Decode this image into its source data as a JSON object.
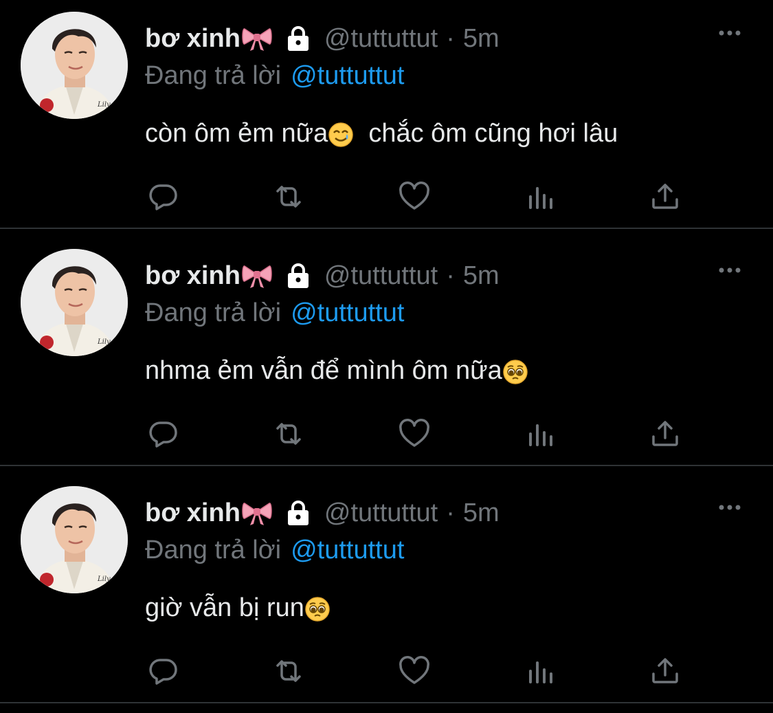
{
  "colors": {
    "background": "#000000",
    "text": "#e7e9ea",
    "muted": "#71767b",
    "link": "#1d9bf0",
    "divider": "#2f3336"
  },
  "tweets": [
    {
      "display_name": "bơ xinh",
      "name_emoji": "ribbon-bow-icon",
      "protected_icon": "lock-icon",
      "handle": "@tuttuttut",
      "separator": "·",
      "time": "5m",
      "reply_prefix": "Đang trả lời",
      "reply_target": "@tuttuttut",
      "text_before_emoji": "còn ôm ẻm nữa",
      "text_emoji": "smiling-face-with-tear-icon",
      "text_after_emoji": "  chắc ôm cũng hơi lâu"
    },
    {
      "display_name": "bơ xinh",
      "name_emoji": "ribbon-bow-icon",
      "protected_icon": "lock-icon",
      "handle": "@tuttuttut",
      "separator": "·",
      "time": "5m",
      "reply_prefix": "Đang trả lời",
      "reply_target": "@tuttuttut",
      "text_before_emoji": "nhma ẻm vẫn để mình ôm nữa",
      "text_emoji": "pleading-face-icon",
      "text_after_emoji": ""
    },
    {
      "display_name": "bơ xinh",
      "name_emoji": "ribbon-bow-icon",
      "protected_icon": "lock-icon",
      "handle": "@tuttuttut",
      "separator": "·",
      "time": "5m",
      "reply_prefix": "Đang trả lời",
      "reply_target": "@tuttuttut",
      "text_before_emoji": "giờ vẫn bị run",
      "text_emoji": "pleading-face-icon",
      "text_after_emoji": ""
    }
  ],
  "action_icons": [
    "reply-icon",
    "retweet-icon",
    "like-icon",
    "views-icon",
    "share-icon"
  ]
}
